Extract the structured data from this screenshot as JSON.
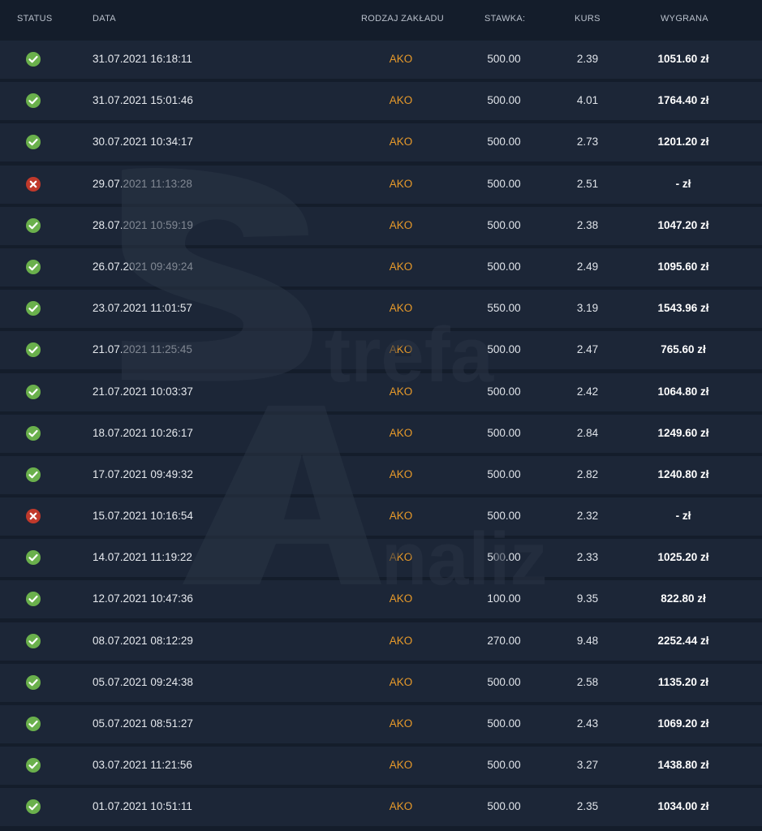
{
  "header": {
    "status": "STATUS",
    "date": "DATA",
    "bet_type": "RODZAJ ZAKŁADU",
    "stake": "STAWKA:",
    "odds": "KURS",
    "win": "WYGRANA"
  },
  "watermark": {
    "line1": "trefa",
    "line2": "naliz"
  },
  "colors": {
    "win": "#6ab04c",
    "loss": "#c0392b",
    "accent": "#e89a2a"
  },
  "rows": [
    {
      "status": "won",
      "date": "31.07.2021 16:18:11",
      "type": "AKO",
      "stake": "500.00",
      "odds": "2.39",
      "win": "1051.60 zł"
    },
    {
      "status": "won",
      "date": "31.07.2021 15:01:46",
      "type": "AKO",
      "stake": "500.00",
      "odds": "4.01",
      "win": "1764.40 zł"
    },
    {
      "status": "won",
      "date": "30.07.2021 10:34:17",
      "type": "AKO",
      "stake": "500.00",
      "odds": "2.73",
      "win": "1201.20 zł"
    },
    {
      "status": "lost",
      "date": "29.07.2021 11:13:28",
      "type": "AKO",
      "stake": "500.00",
      "odds": "2.51",
      "win": "- zł"
    },
    {
      "status": "won",
      "date": "28.07.2021 10:59:19",
      "type": "AKO",
      "stake": "500.00",
      "odds": "2.38",
      "win": "1047.20 zł"
    },
    {
      "status": "won",
      "date": "26.07.2021 09:49:24",
      "type": "AKO",
      "stake": "500.00",
      "odds": "2.49",
      "win": "1095.60 zł"
    },
    {
      "status": "won",
      "date": "23.07.2021 11:01:57",
      "type": "AKO",
      "stake": "550.00",
      "odds": "3.19",
      "win": "1543.96 zł"
    },
    {
      "status": "won",
      "date": "21.07.2021 11:25:45",
      "type": "AKO",
      "stake": "500.00",
      "odds": "2.47",
      "win": "765.60 zł"
    },
    {
      "status": "won",
      "date": "21.07.2021 10:03:37",
      "type": "AKO",
      "stake": "500.00",
      "odds": "2.42",
      "win": "1064.80 zł"
    },
    {
      "status": "won",
      "date": "18.07.2021 10:26:17",
      "type": "AKO",
      "stake": "500.00",
      "odds": "2.84",
      "win": "1249.60 zł"
    },
    {
      "status": "won",
      "date": "17.07.2021 09:49:32",
      "type": "AKO",
      "stake": "500.00",
      "odds": "2.82",
      "win": "1240.80 zł"
    },
    {
      "status": "lost",
      "date": "15.07.2021 10:16:54",
      "type": "AKO",
      "stake": "500.00",
      "odds": "2.32",
      "win": "- zł"
    },
    {
      "status": "won",
      "date": "14.07.2021 11:19:22",
      "type": "AKO",
      "stake": "500.00",
      "odds": "2.33",
      "win": "1025.20 zł"
    },
    {
      "status": "won",
      "date": "12.07.2021 10:47:36",
      "type": "AKO",
      "stake": "100.00",
      "odds": "9.35",
      "win": "822.80 zł"
    },
    {
      "status": "won",
      "date": "08.07.2021 08:12:29",
      "type": "AKO",
      "stake": "270.00",
      "odds": "9.48",
      "win": "2252.44 zł"
    },
    {
      "status": "won",
      "date": "05.07.2021 09:24:38",
      "type": "AKO",
      "stake": "500.00",
      "odds": "2.58",
      "win": "1135.20 zł"
    },
    {
      "status": "won",
      "date": "05.07.2021 08:51:27",
      "type": "AKO",
      "stake": "500.00",
      "odds": "2.43",
      "win": "1069.20 zł"
    },
    {
      "status": "won",
      "date": "03.07.2021 11:21:56",
      "type": "AKO",
      "stake": "500.00",
      "odds": "3.27",
      "win": "1438.80 zł"
    },
    {
      "status": "won",
      "date": "01.07.2021 10:51:11",
      "type": "AKO",
      "stake": "500.00",
      "odds": "2.35",
      "win": "1034.00 zł"
    }
  ]
}
